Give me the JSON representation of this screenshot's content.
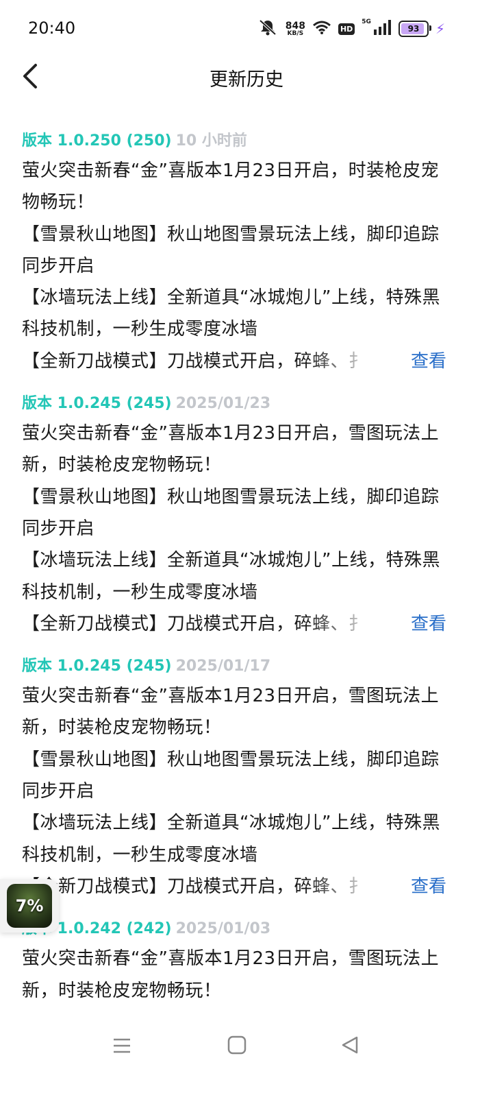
{
  "status_bar": {
    "time": "20:40",
    "net_speed": "848",
    "net_unit": "KB/S",
    "hd": "HD",
    "signal_label": "5G",
    "battery": "93"
  },
  "header": {
    "title": "更新历史"
  },
  "view_more_label": "查看",
  "versions": [
    {
      "version": "版本 1.0.250 (250)",
      "date": "10 小时前",
      "lines": [
        "萤火突击新春“金”喜版本1月23日开启，时装枪皮宠",
        "物畅玩！",
        "【雪景秋山地图】秋山地图雪景玩法上线，脚印追踪",
        "同步开启",
        "【冰墙玩法上线】全新道具“冰城炮儿”上线，特殊黑",
        "科技机制，一秒生成零度冰墙",
        "【全新刀战模式】刀战模式开启，碎蜂、扌"
      ]
    },
    {
      "version": "版本 1.0.245 (245)",
      "date": "2025/01/23",
      "lines": [
        "萤火突击新春“金”喜版本1月23日开启，雪图玩法上",
        "新，时装枪皮宠物畅玩！",
        "【雪景秋山地图】秋山地图雪景玩法上线，脚印追踪",
        "同步开启",
        "【冰墙玩法上线】全新道具“冰城炮儿”上线，特殊黑",
        "科技机制，一秒生成零度冰墙",
        "【全新刀战模式】刀战模式开启，碎蜂、扌"
      ]
    },
    {
      "version": "版本 1.0.245 (245)",
      "date": "2025/01/17",
      "lines": [
        "萤火突击新春“金”喜版本1月23日开启，雪图玩法上",
        "新，时装枪皮宠物畅玩！",
        "【雪景秋山地图】秋山地图雪景玩法上线，脚印追踪",
        "同步开启",
        "【冰墙玩法上线】全新道具“冰城炮儿”上线，特殊黑",
        "科技机制，一秒生成零度冰墙",
        "【全新刀战模式】刀战模式开启，碎蜂、扌"
      ]
    },
    {
      "version": "版本 1.0.242 (242)",
      "date": "2025/01/03",
      "lines": [
        "萤火突击新春“金”喜版本1月23日开启，雪图玩法上",
        "新，时装枪皮宠物畅玩！"
      ]
    }
  ],
  "float_widget": {
    "percent": "7%"
  }
}
